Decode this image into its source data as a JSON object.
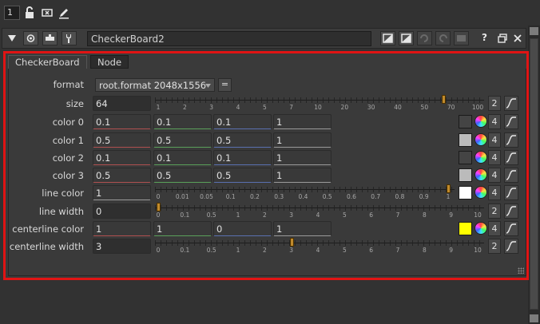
{
  "toolbar": {
    "panel_count": "1",
    "icons": [
      "lock-icon",
      "clear-panels-icon",
      "pencil-icon"
    ]
  },
  "header": {
    "node_name": "CheckerBoard2",
    "help_label": "?",
    "icons": [
      "collapse-triangle-icon",
      "viewer-icon",
      "input-icon",
      "wrench-icon",
      "node-color-icon",
      "alt-color-icon",
      "undo-icon",
      "redo-icon",
      "revert-icon",
      "float-icon",
      "close-icon"
    ]
  },
  "tabs": [
    {
      "label": "CheckerBoard",
      "active": true
    },
    {
      "label": "Node",
      "active": false
    }
  ],
  "params": {
    "format": {
      "label": "format",
      "value": "root.format 2048x1556",
      "eq": "="
    },
    "size": {
      "label": "size",
      "value": "64",
      "channels": "2",
      "slider": {
        "ticks": [
          "1",
          "2",
          "3",
          "4",
          "5",
          "7",
          "10",
          "20",
          "30",
          "40",
          "50",
          "70",
          "100"
        ],
        "value": 64
      }
    },
    "colors": [
      {
        "label": "color 0",
        "values": [
          "0.1",
          "0.1",
          "0.1",
          "1"
        ],
        "swatch": "#444444",
        "channels": "4"
      },
      {
        "label": "color 1",
        "values": [
          "0.5",
          "0.5",
          "0.5",
          "1"
        ],
        "swatch": "#bbbbbb",
        "channels": "4"
      },
      {
        "label": "color 2",
        "values": [
          "0.1",
          "0.1",
          "0.1",
          "1"
        ],
        "swatch": "#444444",
        "channels": "4"
      },
      {
        "label": "color 3",
        "values": [
          "0.5",
          "0.5",
          "0.5",
          "1"
        ],
        "swatch": "#bbbbbb",
        "channels": "4"
      }
    ],
    "line_color": {
      "label": "line color",
      "value": "1",
      "swatch": "#ffffff",
      "channels": "4",
      "slider": {
        "ticks": [
          "0",
          "0.01",
          "0.05",
          "0.1",
          "0.2",
          "0.3",
          "0.4",
          "0.5",
          "0.6",
          "0.7",
          "0.8",
          "0.9",
          "1"
        ],
        "value": 1
      }
    },
    "line_width": {
      "label": "line width",
      "value": "0",
      "channels": "2",
      "slider": {
        "ticks": [
          "0",
          "0.1",
          "0.5",
          "1",
          "2",
          "3",
          "4",
          "5",
          "6",
          "7",
          "8",
          "9",
          "10"
        ],
        "value": 0
      }
    },
    "centerline_color": {
      "label": "centerline color",
      "values": [
        "1",
        "1",
        "0",
        "1"
      ],
      "swatch": "#ffff00",
      "channels": "4"
    },
    "centerline_width": {
      "label": "centerline width",
      "value": "3",
      "channels": "2",
      "slider": {
        "ticks": [
          "0",
          "0.1",
          "0.5",
          "1",
          "2",
          "3",
          "4",
          "5",
          "6",
          "7",
          "8",
          "9",
          "10"
        ],
        "value": 3
      }
    }
  }
}
